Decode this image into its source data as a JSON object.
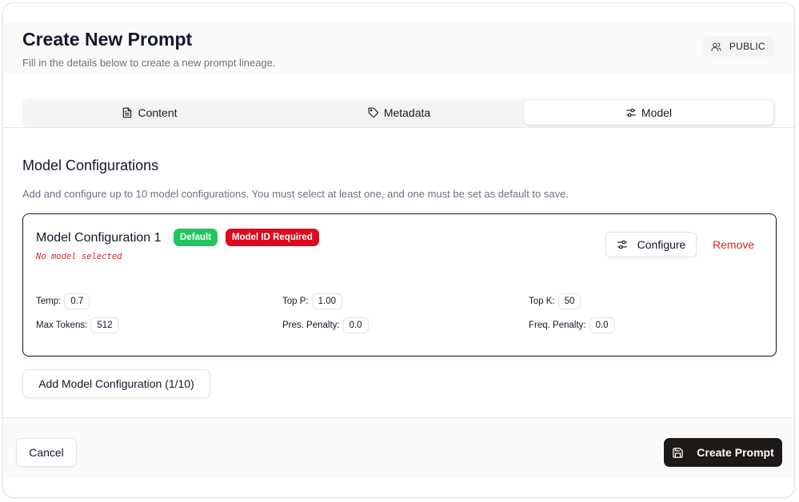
{
  "header": {
    "title": "Create New Prompt",
    "subtitle": "Fill in the details below to create a new prompt lineage.",
    "visibility_label": "PUBLIC",
    "visibility_icon": "users-icon"
  },
  "tabs": [
    {
      "label": "Content",
      "icon": "file-text-icon",
      "active": false
    },
    {
      "label": "Metadata",
      "icon": "tag-icon",
      "active": false
    },
    {
      "label": "Model",
      "icon": "sliders-icon",
      "active": true
    }
  ],
  "section": {
    "title": "Model Configurations",
    "description": "Add and configure up to 10 model configurations. You must select at least one, and one must be set as default to save."
  },
  "config": {
    "name": "Model Configuration 1",
    "badge_default": "Default",
    "badge_error": "Model ID Required",
    "no_model": "No model selected",
    "configure_label": "Configure",
    "remove_label": "Remove",
    "params": {
      "temp_label": "Temp:",
      "temp_value": "0.7",
      "top_p_label": "Top P:",
      "top_p_value": "1.00",
      "top_k_label": "Top K:",
      "top_k_value": "50",
      "max_tokens_label": "Max Tokens:",
      "max_tokens_value": "512",
      "pres_penalty_label": "Pres. Penalty:",
      "pres_penalty_value": "0.0",
      "freq_penalty_label": "Freq. Penalty:",
      "freq_penalty_value": "0.0"
    }
  },
  "add_config_label": "Add Model Configuration (1/10)",
  "footer": {
    "cancel_label": "Cancel",
    "create_label": "Create Prompt"
  },
  "colors": {
    "accent_dark": "#1c1917",
    "success": "#22c55e",
    "danger": "#dc0a1e"
  }
}
